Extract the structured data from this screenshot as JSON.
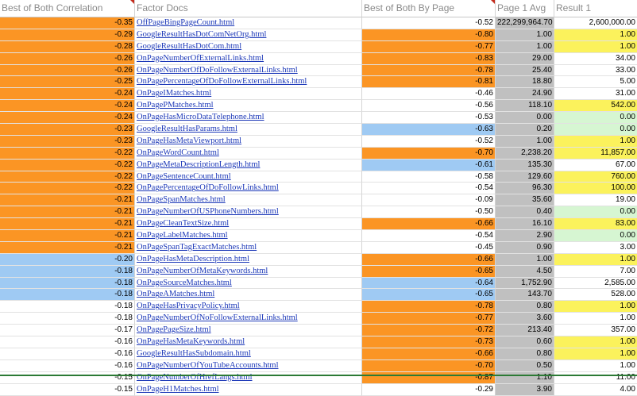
{
  "headers": [
    "Best of Both Correlation",
    "Factor Docs",
    "Best of Both By Page",
    "Page 1 Avg",
    "Result 1"
  ],
  "rows": [
    {
      "corr": "-0.35",
      "doc": "OffPageBingPageCount.html",
      "byPage": "-0.52",
      "avg": "222,299,964.70",
      "result": "2,600,000.00",
      "c1": "orange",
      "c3": "",
      "c5": ""
    },
    {
      "corr": "-0.29",
      "doc": "GoogleResultHasDotComNetOrg.html",
      "byPage": "-0.80",
      "avg": "1.00",
      "result": "1.00",
      "c1": "orange",
      "c3": "orange",
      "c5": "yellow"
    },
    {
      "corr": "-0.28",
      "doc": "GoogleResultHasDotCom.html",
      "byPage": "-0.77",
      "avg": "1.00",
      "result": "1.00",
      "c1": "orange",
      "c3": "orange",
      "c5": "yellow"
    },
    {
      "corr": "-0.26",
      "doc": "OnPageNumberOfExternalLinks.html",
      "byPage": "-0.83",
      "avg": "29.00",
      "result": "34.00",
      "c1": "orange",
      "c3": "orange",
      "c5": ""
    },
    {
      "corr": "-0.26",
      "doc": "OnPageNumberOfDoFollowExternalLinks.html",
      "byPage": "-0.78",
      "avg": "25.40",
      "result": "33.00",
      "c1": "orange",
      "c3": "orange",
      "c5": ""
    },
    {
      "corr": "-0.25",
      "doc": "OnPagePercentageOfDoFollowExternalLinks.html",
      "byPage": "-0.81",
      "avg": "18.80",
      "result": "5.00",
      "c1": "orange",
      "c3": "orange",
      "c5": ""
    },
    {
      "corr": "-0.24",
      "doc": "OnPageIMatches.html",
      "byPage": "-0.46",
      "avg": "24.90",
      "result": "31.00",
      "c1": "orange",
      "c3": "",
      "c5": ""
    },
    {
      "corr": "-0.24",
      "doc": "OnPagePMatches.html",
      "byPage": "-0.56",
      "avg": "118.10",
      "result": "542.00",
      "c1": "orange",
      "c3": "",
      "c5": "yellow"
    },
    {
      "corr": "-0.24",
      "doc": "OnPageHasMicroDataTelephone.html",
      "byPage": "-0.53",
      "avg": "0.00",
      "result": "0.00",
      "c1": "orange",
      "c3": "",
      "c5": "green"
    },
    {
      "corr": "-0.23",
      "doc": "GoogleResultHasParams.html",
      "byPage": "-0.63",
      "avg": "0.20",
      "result": "0.00",
      "c1": "orange",
      "c3": "blue",
      "c5": "green"
    },
    {
      "corr": "-0.23",
      "doc": "OnPageHasMetaViewport.html",
      "byPage": "-0.52",
      "avg": "1.00",
      "result": "1.00",
      "c1": "orange",
      "c3": "",
      "c5": "yellow"
    },
    {
      "corr": "-0.22",
      "doc": "OnPageWordCount.html",
      "byPage": "-0.70",
      "avg": "2,238.20",
      "result": "11,857.00",
      "c1": "orange",
      "c3": "orange",
      "c5": "yellow"
    },
    {
      "corr": "-0.22",
      "doc": "OnPageMetaDescriptionLength.html",
      "byPage": "-0.61",
      "avg": "135.30",
      "result": "67.00",
      "c1": "orange",
      "c3": "blue",
      "c5": ""
    },
    {
      "corr": "-0.22",
      "doc": "OnPageSentenceCount.html",
      "byPage": "-0.58",
      "avg": "129.60",
      "result": "760.00",
      "c1": "orange",
      "c3": "",
      "c5": "yellow"
    },
    {
      "corr": "-0.22",
      "doc": "OnPagePercentageOfDoFollowLinks.html",
      "byPage": "-0.54",
      "avg": "96.30",
      "result": "100.00",
      "c1": "orange",
      "c3": "",
      "c5": "yellow"
    },
    {
      "corr": "-0.21",
      "doc": "OnPageSpanMatches.html",
      "byPage": "-0.09",
      "avg": "35.60",
      "result": "19.00",
      "c1": "orange",
      "c3": "",
      "c5": ""
    },
    {
      "corr": "-0.21",
      "doc": "OnPageNumberOfUSPhoneNumbers.html",
      "byPage": "-0.50",
      "avg": "0.40",
      "result": "0.00",
      "c1": "orange",
      "c3": "",
      "c5": "green"
    },
    {
      "corr": "-0.21",
      "doc": "OnPageCleanTextSize.html",
      "byPage": "-0.66",
      "avg": "16.10",
      "result": "83.00",
      "c1": "orange",
      "c3": "orange",
      "c5": "yellow"
    },
    {
      "corr": "-0.21",
      "doc": "OnPageLabelMatches.html",
      "byPage": "-0.54",
      "avg": "2.90",
      "result": "0.00",
      "c1": "orange",
      "c3": "",
      "c5": "green"
    },
    {
      "corr": "-0.21",
      "doc": "OnPageSpanTagExactMatches.html",
      "byPage": "-0.45",
      "avg": "0.90",
      "result": "3.00",
      "c1": "orange",
      "c3": "",
      "c5": ""
    },
    {
      "corr": "-0.20",
      "doc": "OnPageHasMetaDescription.html",
      "byPage": "-0.66",
      "avg": "1.00",
      "result": "1.00",
      "c1": "blue",
      "c3": "orange",
      "c5": "yellow"
    },
    {
      "corr": "-0.18",
      "doc": "OnPageNumberOfMetaKeywords.html",
      "byPage": "-0.65",
      "avg": "4.50",
      "result": "7.00",
      "c1": "blue",
      "c3": "orange",
      "c5": ""
    },
    {
      "corr": "-0.18",
      "doc": "OnPageSourceMatches.html",
      "byPage": "-0.64",
      "avg": "1,752.90",
      "result": "2,585.00",
      "c1": "blue",
      "c3": "blue",
      "c5": ""
    },
    {
      "corr": "-0.18",
      "doc": "OnPageAMatches.html",
      "byPage": "-0.65",
      "avg": "143.70",
      "result": "528.00",
      "c1": "blue",
      "c3": "blue",
      "c5": ""
    },
    {
      "corr": "-0.18",
      "doc": "OnPageHasPrivacyPolicy.html",
      "byPage": "-0.78",
      "avg": "0.80",
      "result": "1.00",
      "c1": "",
      "c3": "orange",
      "c5": "yellow"
    },
    {
      "corr": "-0.18",
      "doc": "OnPageNumberOfNoFollowExternalLinks.html",
      "byPage": "-0.77",
      "avg": "3.60",
      "result": "1.00",
      "c1": "",
      "c3": "orange",
      "c5": ""
    },
    {
      "corr": "-0.17",
      "doc": "OnPagePageSize.html",
      "byPage": "-0.72",
      "avg": "213.40",
      "result": "357.00",
      "c1": "",
      "c3": "orange",
      "c5": ""
    },
    {
      "corr": "-0.16",
      "doc": "OnPageHasMetaKeywords.html",
      "byPage": "-0.73",
      "avg": "0.60",
      "result": "1.00",
      "c1": "",
      "c3": "orange",
      "c5": "yellow"
    },
    {
      "corr": "-0.16",
      "doc": "GoogleResultHasSubdomain.html",
      "byPage": "-0.66",
      "avg": "0.80",
      "result": "1.00",
      "c1": "",
      "c3": "orange",
      "c5": "yellow"
    },
    {
      "corr": "-0.16",
      "doc": "OnPageNumberOfYouTubeAccounts.html",
      "byPage": "-0.70",
      "avg": "0.50",
      "result": "1.00",
      "c1": "",
      "c3": "orange",
      "c5": ""
    },
    {
      "corr": "-0.15",
      "doc": "OnPageNumberOfHrefLangs.html",
      "byPage": "-0.87",
      "avg": "1.10",
      "result": "11.00",
      "c1": "",
      "c3": "orange",
      "c5": ""
    },
    {
      "corr": "-0.15",
      "doc": "OnPageH1Matches.html",
      "byPage": "-0.29",
      "avg": "3.90",
      "result": "4.00",
      "c1": "",
      "c3": "",
      "c5": ""
    }
  ],
  "colors": {
    "orange": "#fb9524",
    "blue": "#9fcaf3",
    "gray": "#c0c0c0",
    "yellow": "#fbf25c",
    "green": "#d6f6d2",
    "link": "#1c38b8",
    "comment_marker": "#c42b1c",
    "freeze_line": "#2c7a35"
  }
}
